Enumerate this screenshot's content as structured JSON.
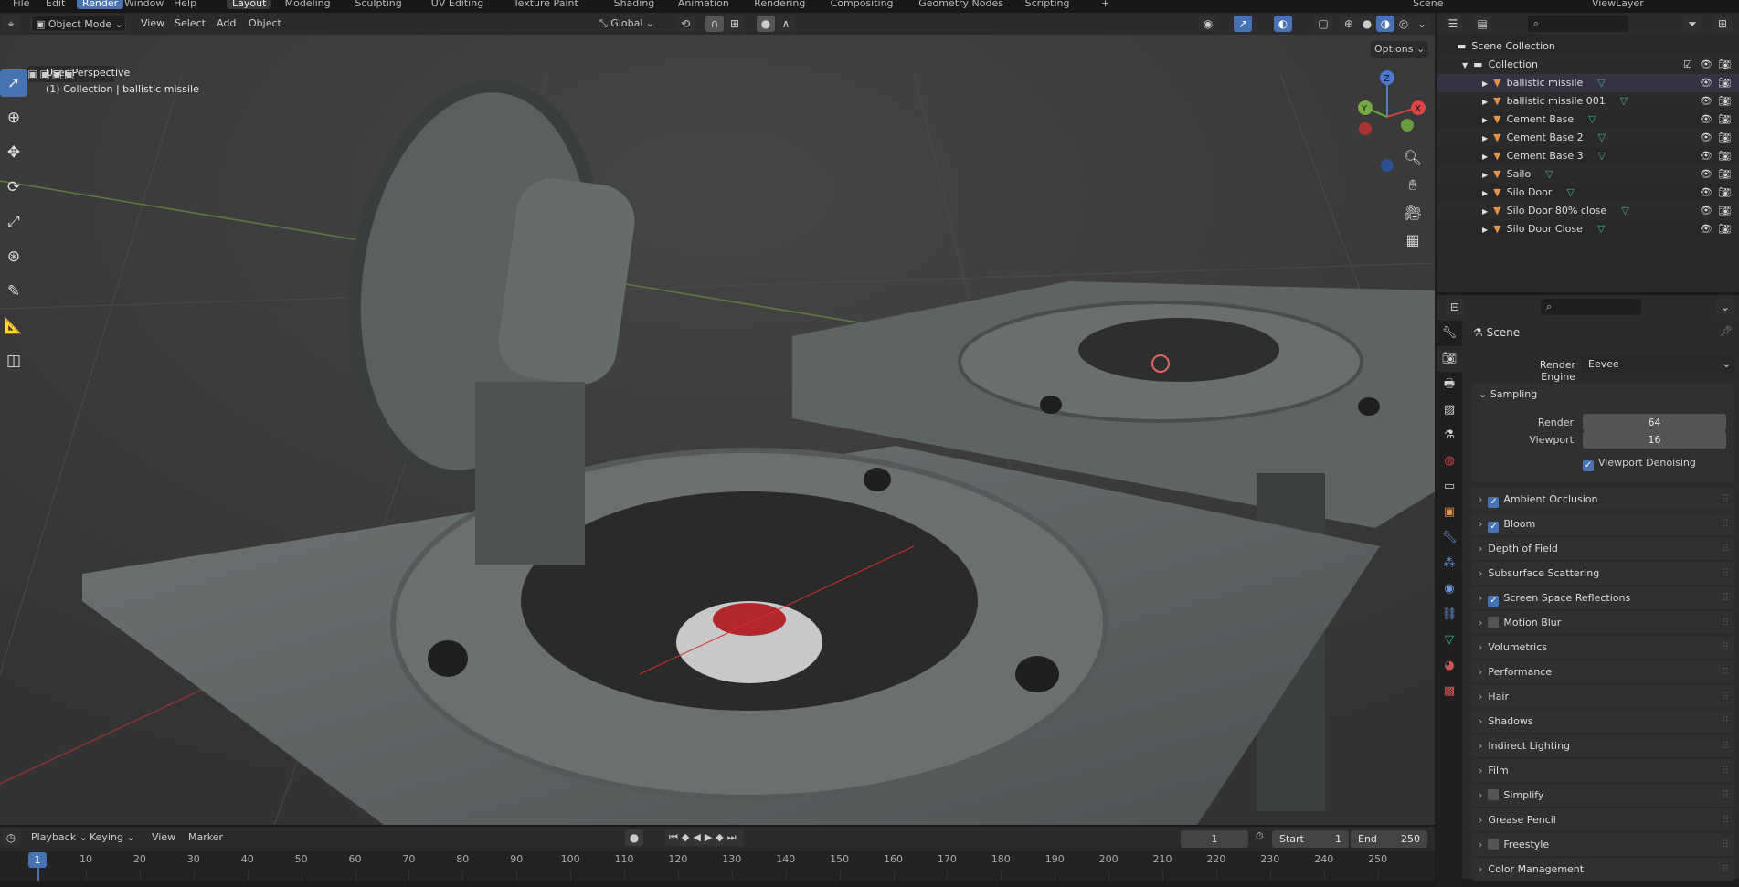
{
  "topbar": {
    "menus": [
      "File",
      "Edit",
      "Render",
      "Window",
      "Help"
    ],
    "workspaces": [
      "Layout",
      "Modeling",
      "Sculpting",
      "UV Editing",
      "Texture Paint",
      "Shading",
      "Animation",
      "Rendering",
      "Compositing",
      "Geometry Nodes",
      "Scripting"
    ],
    "add_tab": "+",
    "scene": "Scene",
    "view_layer": "ViewLayer"
  },
  "viewport_header": {
    "mode": "Object Mode",
    "menus": [
      "View",
      "Select",
      "Add",
      "Object"
    ],
    "orientation": "Global",
    "options": "Options"
  },
  "viewport": {
    "perspective": "User Perspective",
    "collection_info": "(1) Collection | ballistic missile",
    "gizmo": {
      "x": "X",
      "y": "Y",
      "z": "Z"
    }
  },
  "outliner": {
    "scene_collection": "Scene Collection",
    "collection": "Collection",
    "items": [
      "ballistic missile",
      "ballistic missile 001",
      "Cement  Base",
      "Cement  Base 2",
      "Cement  Base 3",
      "Sailo",
      "Silo Door",
      "Silo Door 80% close",
      "Silo Door Close"
    ]
  },
  "properties": {
    "context": "Scene",
    "render_engine_label": "Render Engine",
    "render_engine": "Eevee",
    "sampling": {
      "title": "Sampling",
      "render_label": "Render",
      "render": "64",
      "viewport_label": "Viewport",
      "viewport": "16",
      "denoise": "Viewport Denoising"
    },
    "panels": [
      {
        "label": "Ambient Occlusion",
        "checkbox": true,
        "checked": true
      },
      {
        "label": "Bloom",
        "checkbox": true,
        "checked": true
      },
      {
        "label": "Depth of Field",
        "checkbox": false
      },
      {
        "label": "Subsurface Scattering",
        "checkbox": false
      },
      {
        "label": "Screen Space Reflections",
        "checkbox": true,
        "checked": true
      },
      {
        "label": "Motion Blur",
        "checkbox": true,
        "checked": false
      },
      {
        "label": "Volumetrics",
        "checkbox": false
      },
      {
        "label": "Performance",
        "checkbox": false
      },
      {
        "label": "Hair",
        "checkbox": false
      },
      {
        "label": "Shadows",
        "checkbox": false
      },
      {
        "label": "Indirect Lighting",
        "checkbox": false
      },
      {
        "label": "Film",
        "checkbox": false
      },
      {
        "label": "Simplify",
        "checkbox": true,
        "checked": false
      },
      {
        "label": "Grease Pencil",
        "checkbox": false
      },
      {
        "label": "Freestyle",
        "checkbox": true,
        "checked": false
      },
      {
        "label": "Color Management",
        "checkbox": false
      }
    ]
  },
  "timeline": {
    "menus": [
      "Playback",
      "Keying",
      "View",
      "Marker"
    ],
    "current_frame": "1",
    "start_label": "Start",
    "start": "1",
    "end_label": "End",
    "end": "250",
    "playhead": "1",
    "ticks": [
      "10",
      "20",
      "30",
      "40",
      "50",
      "60",
      "70",
      "80",
      "90",
      "100",
      "110",
      "120",
      "130",
      "140",
      "150",
      "160",
      "170",
      "180",
      "190",
      "200",
      "210",
      "220",
      "230",
      "240",
      "250"
    ]
  },
  "colors": {
    "accent": "#4772b3",
    "object": "#e3924a",
    "mesh": "#3fb39a"
  }
}
